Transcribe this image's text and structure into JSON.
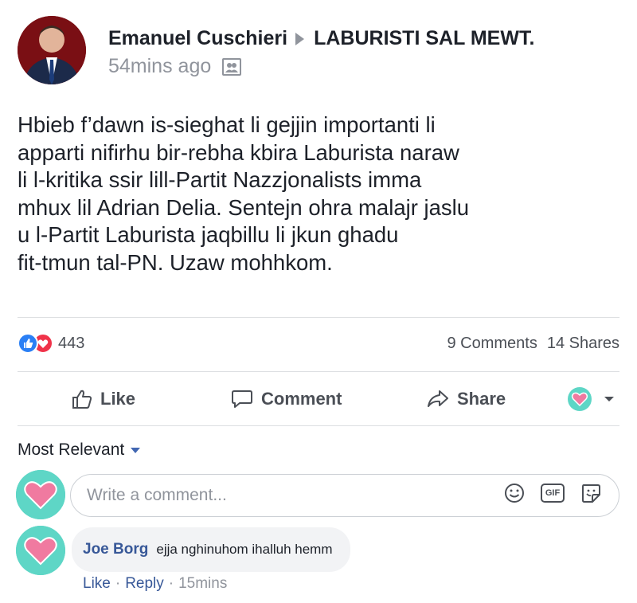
{
  "post": {
    "author": "Emanuel Cuschieri",
    "group": "LABURISTI SAL MEWT.",
    "time": "54mins ago",
    "privacy_icon": "group-icon",
    "body_lines": [
      "Hbieb f’dawn is-sieghat li gejjin importanti li",
      "apparti nifirhu bir-rebha kbira Laburista naraw",
      "li l-kritika ssir lill-Partit Nazzjonalists imma",
      "mhux lil Adrian Delia. Sentejn ohra malajr jaslu",
      "u l-Partit Laburista jaqbillu li jkun ghadu",
      "fit-tmun tal-PN. Uzaw mohhkom."
    ]
  },
  "stats": {
    "reactions_count": "443",
    "comments": "9 Comments",
    "shares": "14 Shares"
  },
  "actions": {
    "like": "Like",
    "comment": "Comment",
    "share": "Share"
  },
  "comments_section": {
    "sort_label": "Most Relevant",
    "input_placeholder": "Write a comment...",
    "gif_label": "GIF"
  },
  "comment": {
    "author": "Joe Borg",
    "text": "ejja nghinuhom ihalluh hemm",
    "like": "Like",
    "reply": "Reply",
    "time": "15mins",
    "separator": "·"
  },
  "colors": {
    "link_blue": "#385898",
    "like_blue": "#2a7ff5",
    "love_red": "#f0334a",
    "badge_teal": "#5ed6c6",
    "badge_pink": "#f07aa0"
  }
}
